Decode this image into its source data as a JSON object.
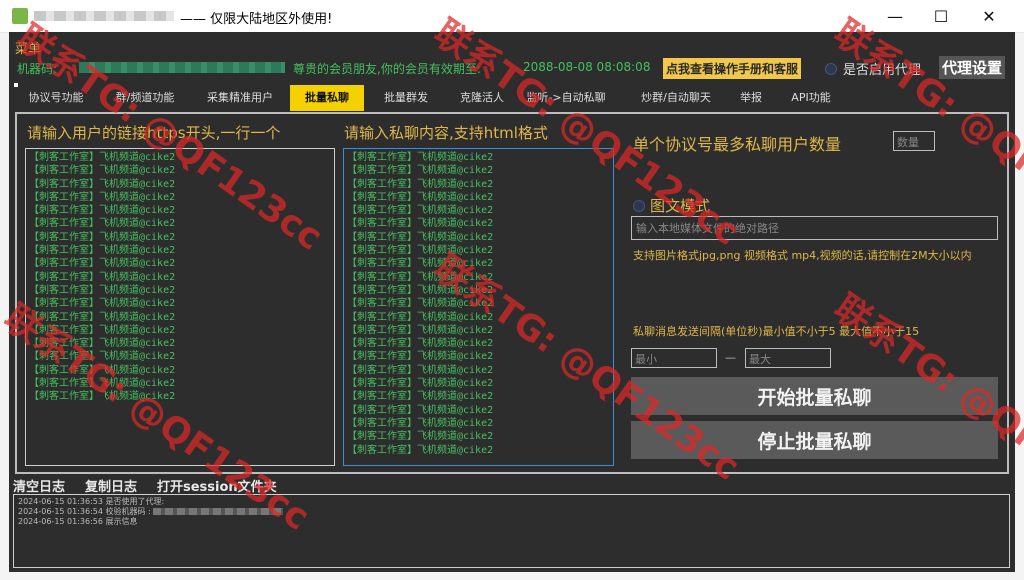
{
  "window": {
    "title": "—— 仅限大陆地区外使用!",
    "minimize": "—",
    "maximize": "☐",
    "close": "✕"
  },
  "menu": {
    "label": "菜单"
  },
  "header": {
    "machine_label": "机器码:",
    "member_text": "尊贵的会员朋友,你的会员有效期至:",
    "expiry": "2088-08-08 08:08:08",
    "manual_button": "点我查看操作手册和客服",
    "proxy_toggle_label": "是否启用代理",
    "proxy_settings_button": "代理设置"
  },
  "tabs": [
    {
      "label": "协议号功能"
    },
    {
      "label": "群/频道功能"
    },
    {
      "label": "采集精准用户"
    },
    {
      "label": "批量私聊",
      "active": true
    },
    {
      "label": "批量群发"
    },
    {
      "label": "克隆活人"
    },
    {
      "label": "监听->自动私聊"
    },
    {
      "label": "炒群/自动聊天"
    },
    {
      "label": "举报"
    },
    {
      "label": "API功能"
    }
  ],
  "panel": {
    "users_heading": "请输入用户的链接https开头,一行一个",
    "content_heading": "请输入私聊内容,支持html格式",
    "max_users_label": "单个协议号最多私聊用户数量",
    "max_users_placeholder": "数量",
    "mode_label": "图文模式",
    "media_path_placeholder": "输入本地媒体文件的绝对路径",
    "format_note": "支持图片格式jpg,png 视频格式 mp4,视频的话,请控制在2M大小以内",
    "interval_label": "私聊消息发送间隔(单位秒)最小值不小于5 最大值不小于15",
    "min_placeholder": "最小",
    "interval_dash": "—",
    "max_placeholder": "最大",
    "start_button": "开始批量私聊",
    "stop_button": "停止批量私聊",
    "users_lines": [
      "【刺客工作室】飞机频道@cike2",
      "【刺客工作室】飞机频道@cike2",
      "【刺客工作室】飞机频道@cike2",
      "【刺客工作室】飞机频道@cike2",
      "【刺客工作室】飞机频道@cike2",
      "【刺客工作室】飞机频道@cike2",
      "【刺客工作室】飞机频道@cike2",
      "【刺客工作室】飞机频道@cike2",
      "【刺客工作室】飞机频道@cike2",
      "【刺客工作室】飞机频道@cike2",
      "【刺客工作室】飞机频道@cike2",
      "【刺客工作室】飞机频道@cike2",
      "【刺客工作室】飞机频道@cike2",
      "【刺客工作室】飞机频道@cike2",
      "【刺客工作室】飞机频道@cike2",
      "【刺客工作室】飞机频道@cike2",
      "【刺客工作室】飞机频道@cike2",
      "【刺客工作室】飞机频道@cike2",
      "【刺客工作室】飞机频道@cike2"
    ],
    "content_lines": [
      "【刺客工作室】飞机频道@cike2",
      "【刺客工作室】飞机频道@cike2",
      "【刺客工作室】飞机频道@cike2",
      "【刺客工作室】飞机频道@cike2",
      "【刺客工作室】飞机频道@cike2",
      "【刺客工作室】飞机频道@cike2",
      "【刺客工作室】飞机频道@cike2",
      "【刺客工作室】飞机频道@cike2",
      "【刺客工作室】飞机频道@cike2",
      "【刺客工作室】飞机频道@cike2",
      "【刺客工作室】飞机频道@cike2",
      "【刺客工作室】飞机频道@cike2",
      "【刺客工作室】飞机频道@cike2",
      "【刺客工作室】飞机频道@cike2",
      "【刺客工作室】飞机频道@cike2",
      "【刺客工作室】飞机频道@cike2",
      "【刺客工作室】飞机频道@cike2",
      "【刺客工作室】飞机频道@cike2",
      "【刺客工作室】飞机频道@cike2",
      "【刺客工作室】飞机频道@cike2",
      "【刺客工作室】飞机频道@cike2",
      "【刺客工作室】飞机频道@cike2",
      "【刺客工作室】飞机频道@cike2"
    ]
  },
  "log": {
    "clear_button": "清空日志",
    "copy_button": "复制日志",
    "open_session_button": "打开session文件夹",
    "entries": [
      {
        "time": "2024-06-15 01:36:53",
        "text": "是否使用了代理:"
      },
      {
        "time": "2024-06-15 01:36:54",
        "text": "校验机器码 :"
      },
      {
        "time": "2024-06-15 01:36:56",
        "text": "展示信息"
      }
    ]
  },
  "watermark": {
    "text": "联系TG: @QF123cc",
    "color": "#dc2828"
  }
}
